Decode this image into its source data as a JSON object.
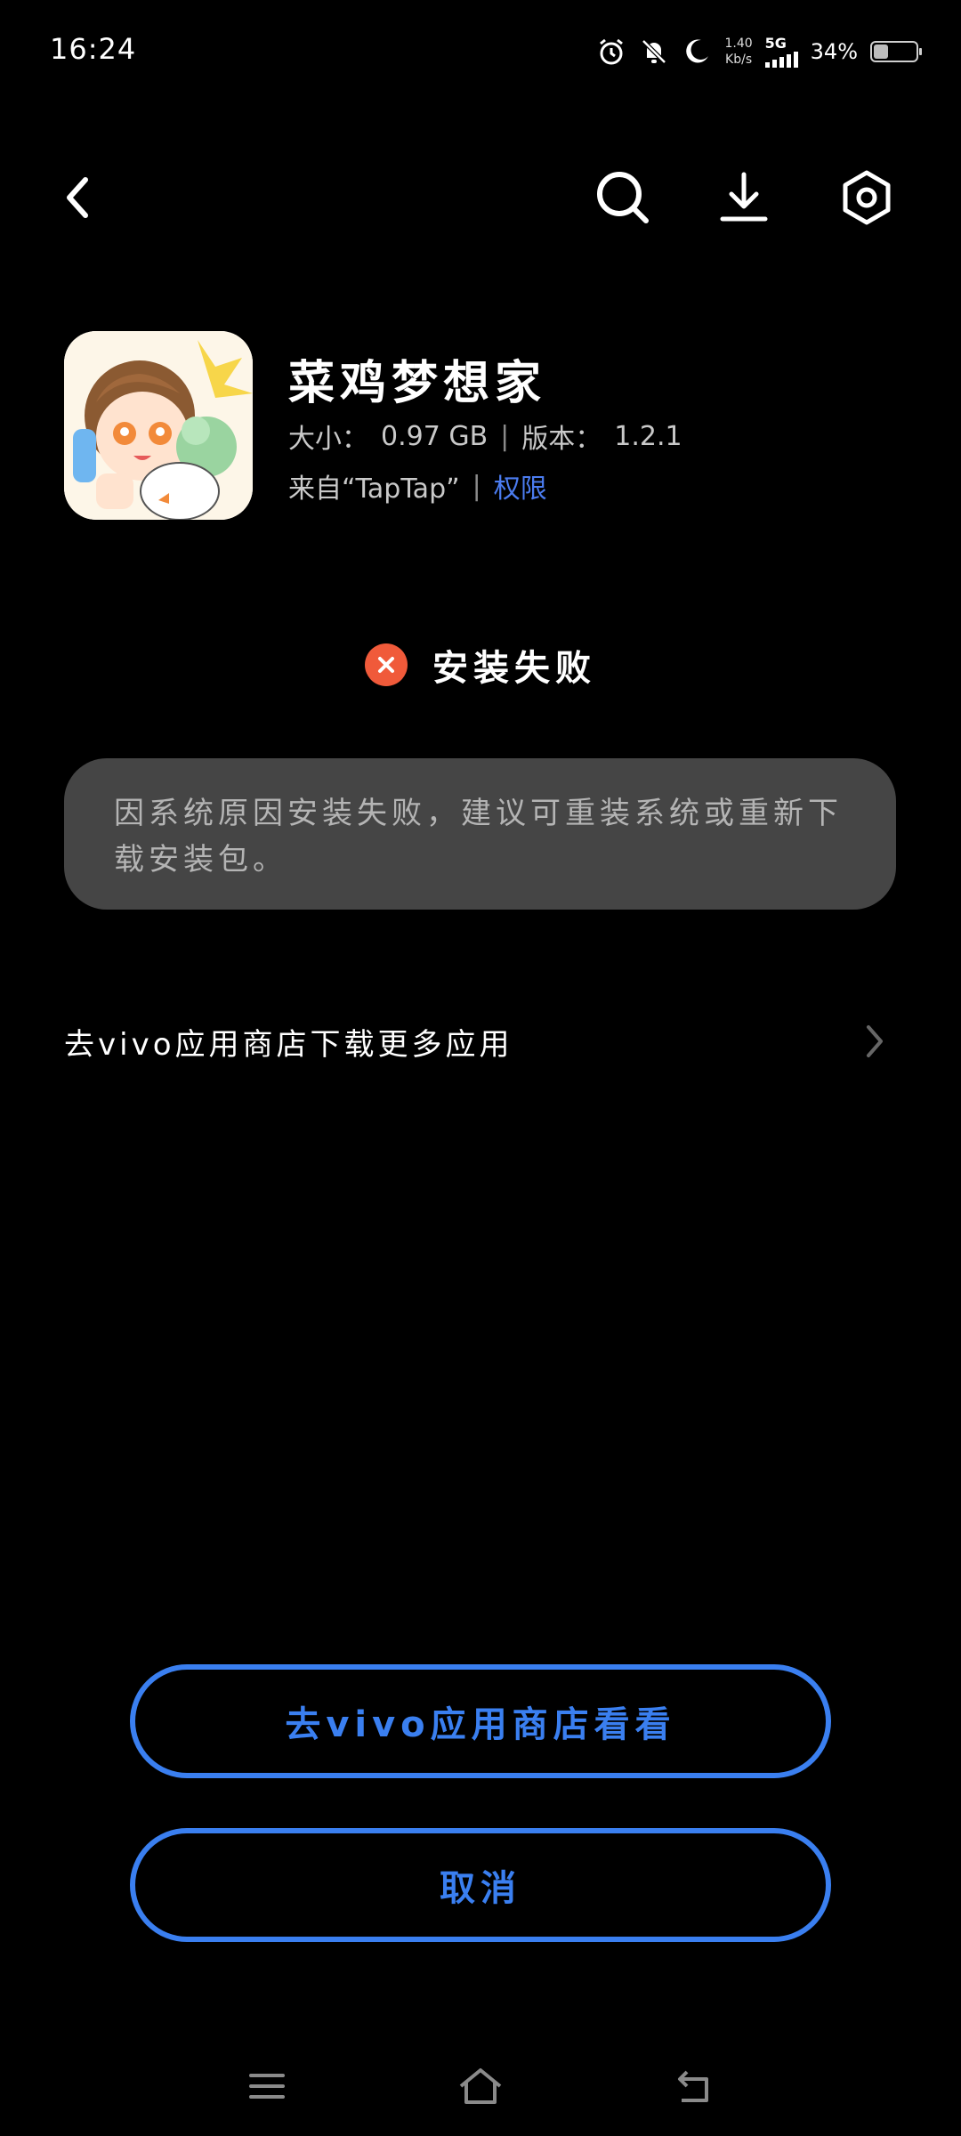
{
  "status_bar": {
    "time": "16:24",
    "net_speed_value": "1.40",
    "net_speed_unit": "Kb/s",
    "network": "5G",
    "battery": "34%",
    "battery_level": 0.34,
    "icons": [
      "alarm-icon",
      "mute-bell-icon",
      "moon-icon"
    ]
  },
  "topnav": {
    "icons": [
      "back-icon",
      "search-icon",
      "download-icon",
      "settings-icon"
    ]
  },
  "app": {
    "name": "菜鸡梦想家",
    "size_label": "大小：",
    "size_value": "0.97 GB",
    "version_label": "版本：",
    "version_value": "1.2.1",
    "source": "来自“TapTap”",
    "permission_link": "权限"
  },
  "status": {
    "text": "安装失败",
    "color": "#f05a3a"
  },
  "message": {
    "text": "因系统原因安装失败，建议可重装系统或重新下载安装包。"
  },
  "store_link": {
    "label": "去vivo应用商店下载更多应用"
  },
  "buttons": {
    "store": "去vivo应用商店看看",
    "cancel": "取消",
    "accent": "#3a7ff0"
  },
  "navbar": {
    "icons": [
      "menu-icon",
      "home-icon",
      "back-nav-icon"
    ]
  }
}
